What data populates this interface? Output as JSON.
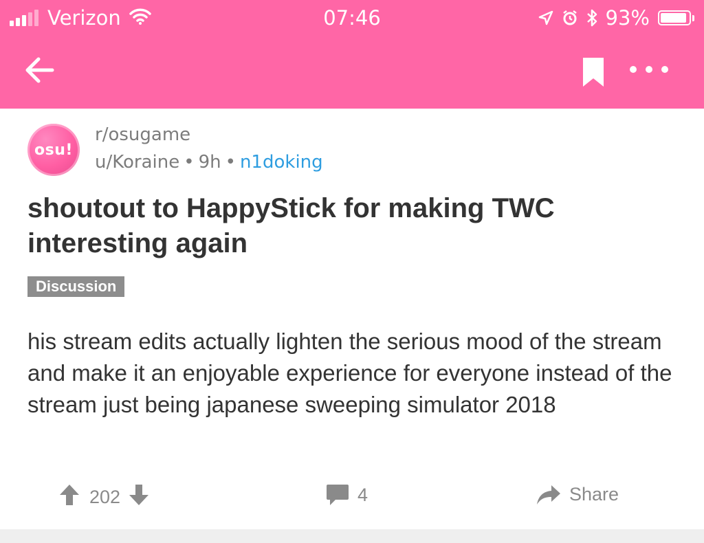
{
  "status_bar": {
    "carrier": "Verizon",
    "time": "07:46",
    "battery": "93%",
    "battery_level": 0.93
  },
  "toolbar": {
    "back_icon": "arrow-left-icon",
    "bookmark_icon": "bookmark-icon",
    "more_icon": "more-horizontal-icon"
  },
  "post": {
    "avatar_text": "osu!",
    "subreddit": "r/osugame",
    "author": "u/Koraine",
    "age": "9h",
    "flair": "n1doking",
    "title": "shoutout to HappyStick for making TWC interesting again",
    "tag": "Discussion",
    "body": "his stream edits actually lighten the serious mood of the stream and make it an enjoyable experience for everyone instead of the stream just being japanese sweeping simulator 2018"
  },
  "actions": {
    "upvote_icon": "arrow-up-icon",
    "score": "202",
    "downvote_icon": "arrow-down-icon",
    "comment_icon": "comment-icon",
    "comments": "4",
    "share_icon": "share-icon",
    "share_label": "Share"
  },
  "colors": {
    "header": "#ff66a6",
    "flair": "#2e9de0",
    "tag_bg": "#8d8d8d"
  }
}
